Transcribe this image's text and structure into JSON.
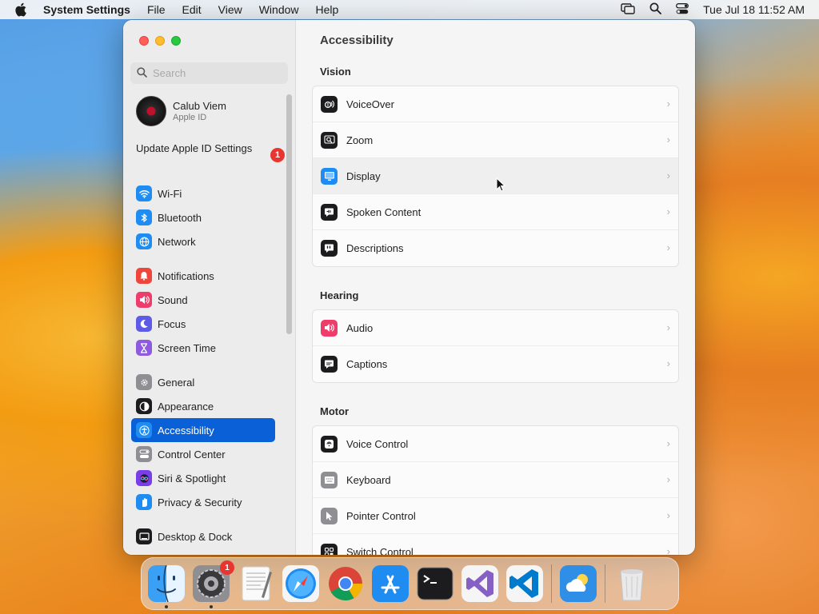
{
  "menubar": {
    "app": "System Settings",
    "items": [
      "File",
      "Edit",
      "View",
      "Window",
      "Help"
    ],
    "clock": "Tue Jul 18  11:52 AM"
  },
  "sidebar": {
    "search_placeholder": "Search",
    "profile": {
      "name": "Calub Viem",
      "sub": "Apple ID"
    },
    "update": {
      "label": "Update Apple ID Settings",
      "badge": "1"
    },
    "groups": [
      [
        {
          "label": "Wi-Fi",
          "icon": "wifi-icon",
          "color": "#1e8cf0"
        },
        {
          "label": "Bluetooth",
          "icon": "bluetooth-icon",
          "color": "#1e8cf0"
        },
        {
          "label": "Network",
          "icon": "globe-icon",
          "color": "#1e8cf0"
        }
      ],
      [
        {
          "label": "Notifications",
          "icon": "bell-icon",
          "color": "#f0453a"
        },
        {
          "label": "Sound",
          "icon": "speaker-icon",
          "color": "#ef3d6b"
        },
        {
          "label": "Focus",
          "icon": "moon-icon",
          "color": "#5e5ce6"
        },
        {
          "label": "Screen Time",
          "icon": "hourglass-icon",
          "color": "#8e5be0"
        }
      ],
      [
        {
          "label": "General",
          "icon": "gear-icon",
          "color": "#8e8e93"
        },
        {
          "label": "Appearance",
          "icon": "appearance-icon",
          "color": "#1c1c1e"
        },
        {
          "label": "Accessibility",
          "icon": "accessibility-icon",
          "color": "#1e8cf0"
        },
        {
          "label": "Control Center",
          "icon": "toggles-icon",
          "color": "#8e8e93"
        },
        {
          "label": "Siri & Spotlight",
          "icon": "siri-icon",
          "color": "#7a3ee8"
        },
        {
          "label": "Privacy & Security",
          "icon": "hand-icon",
          "color": "#1e8cf0"
        }
      ],
      [
        {
          "label": "Desktop & Dock",
          "icon": "desktop-icon",
          "color": "#1c1c1e"
        }
      ]
    ]
  },
  "main": {
    "title": "Accessibility",
    "sections": [
      {
        "heading": "Vision",
        "rows": [
          {
            "label": "VoiceOver",
            "icon": "voiceover-icon",
            "color": "#1c1c1e"
          },
          {
            "label": "Zoom",
            "icon": "zoom-icon",
            "color": "#1c1c1e"
          },
          {
            "label": "Display",
            "icon": "display-icon",
            "color": "#1e8cf0"
          },
          {
            "label": "Spoken Content",
            "icon": "speech-bubble-icon",
            "color": "#1c1c1e"
          },
          {
            "label": "Descriptions",
            "icon": "quote-bubble-icon",
            "color": "#1c1c1e"
          }
        ]
      },
      {
        "heading": "Hearing",
        "rows": [
          {
            "label": "Audio",
            "icon": "speaker-icon",
            "color": "#ef3d6b"
          },
          {
            "label": "Captions",
            "icon": "captions-icon",
            "color": "#1c1c1e"
          }
        ]
      },
      {
        "heading": "Motor",
        "rows": [
          {
            "label": "Voice Control",
            "icon": "voice-control-icon",
            "color": "#1c1c1e"
          },
          {
            "label": "Keyboard",
            "icon": "keyboard-icon",
            "color": "#8e8e93"
          },
          {
            "label": "Pointer Control",
            "icon": "pointer-icon",
            "color": "#8e8e93"
          },
          {
            "label": "Switch Control",
            "icon": "switch-grid-icon",
            "color": "#1c1c1e"
          }
        ]
      }
    ]
  },
  "dock": {
    "apps": [
      {
        "name": "finder-icon",
        "running": true
      },
      {
        "name": "system-settings-icon",
        "running": true,
        "badge": "1"
      },
      {
        "name": "textedit-icon"
      },
      {
        "name": "safari-icon"
      },
      {
        "name": "chrome-icon"
      },
      {
        "name": "app-store-icon"
      },
      {
        "name": "terminal-icon"
      },
      {
        "name": "visual-studio-icon"
      },
      {
        "name": "vscode-icon"
      },
      {
        "name": "weather-icon"
      },
      {
        "name": "trash-icon"
      }
    ]
  }
}
